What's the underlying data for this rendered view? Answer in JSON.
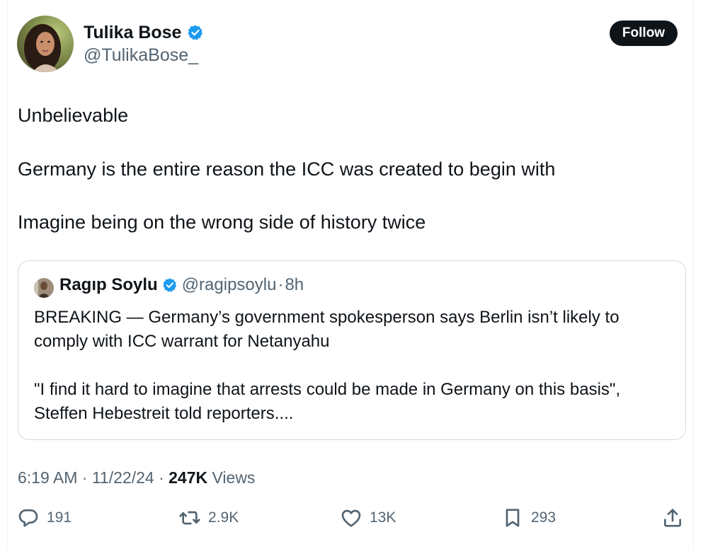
{
  "author": {
    "display_name": "Tulika Bose",
    "handle": "@TulikaBose_",
    "verified": true,
    "follow_label": "Follow"
  },
  "tweet": {
    "lines": [
      "Unbelievable",
      "Germany is the entire reason the ICC was created to begin with",
      "Imagine being on the wrong side of history twice"
    ]
  },
  "quote": {
    "display_name": "Ragıp Soylu",
    "handle": "@ragipsoylu",
    "separator": "·",
    "time": "8h",
    "verified": true,
    "lines": [
      "BREAKING — Germany’s government spokesperson says Berlin isn’t likely to",
      "comply with ICC warrant for Netanyahu",
      "\"I find it hard to imagine that arrests could be made in Germany on this basis\",",
      "Steffen Hebestreit told reporters...."
    ]
  },
  "meta": {
    "time": "6:19 AM",
    "sep1": "·",
    "date": "11/22/24",
    "sep2": "·",
    "views_count": "247K",
    "views_label": "Views"
  },
  "actions": {
    "reply_count": "191",
    "retweet_count": "2.9K",
    "like_count": "13K",
    "bookmark_count": "293"
  },
  "colors": {
    "text_primary": "#0f1419",
    "text_secondary": "#536471",
    "verified_blue": "#1d9bf0",
    "border": "#cfd9de"
  },
  "icons": {
    "verified": "verified-badge-icon",
    "reply": "reply-icon",
    "retweet": "retweet-icon",
    "like": "heart-icon",
    "bookmark": "bookmark-icon",
    "share": "share-icon"
  }
}
